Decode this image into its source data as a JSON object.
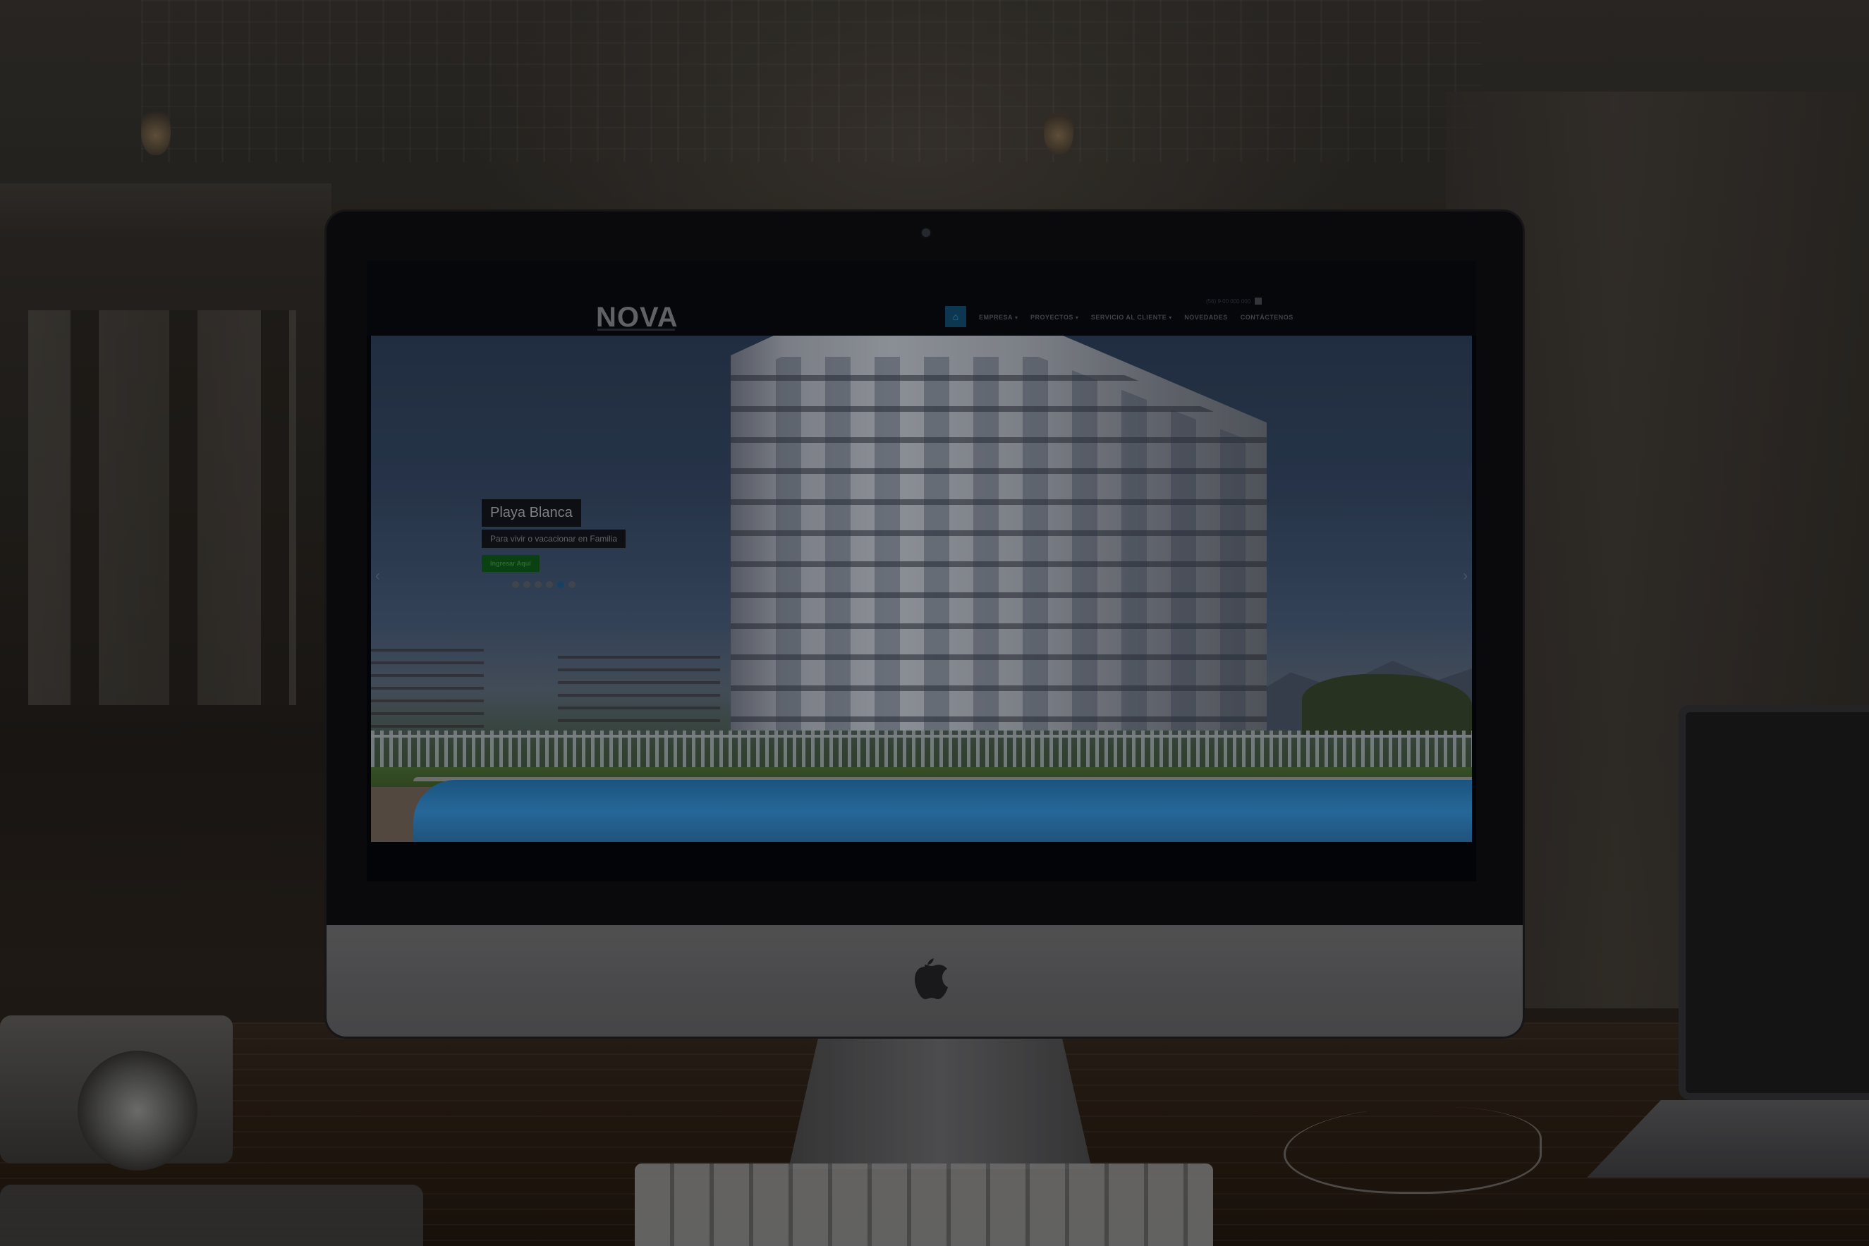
{
  "site": {
    "logo": "NOVA",
    "top_contact": "(56) 9 00 000 000"
  },
  "nav": {
    "home_icon": "home-icon",
    "items": [
      {
        "label": "EMPRESA",
        "has_dropdown": true
      },
      {
        "label": "PROYECTOS",
        "has_dropdown": true
      },
      {
        "label": "SERVICIO AL CLIENTE",
        "has_dropdown": true
      },
      {
        "label": "NOVEDADES",
        "has_dropdown": false
      },
      {
        "label": "CONTÁCTENOS",
        "has_dropdown": false
      }
    ]
  },
  "slider": {
    "title": "Playa Blanca",
    "subtitle": "Para vivir o vacacionar en Familia",
    "button_label": "Ingresar Aquí",
    "dot_count": 6,
    "active_dot": 4,
    "prev_icon": "chevron-left-icon",
    "next_icon": "chevron-right-icon"
  },
  "colors": {
    "nav_active": "#0f3f5c",
    "cta_green": "#0d4a15"
  }
}
